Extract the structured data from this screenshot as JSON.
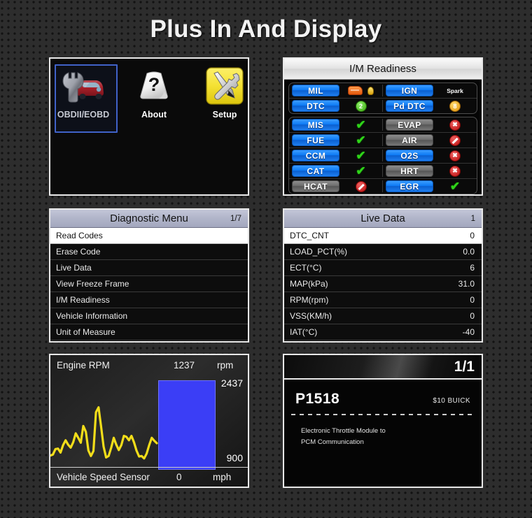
{
  "page": {
    "title": "Plus In And Display"
  },
  "main_menu": {
    "items": [
      {
        "label": "OBDII/EOBD",
        "icon": "wrench-car-icon",
        "selected": true
      },
      {
        "label": "About",
        "icon": "question-mark-icon",
        "selected": false
      },
      {
        "label": "Setup",
        "icon": "wrench-screwdriver-icon",
        "selected": false
      }
    ]
  },
  "im_readiness": {
    "title": "I/M Readiness",
    "group1": [
      {
        "left_label": "MIL",
        "left_style": "blue",
        "left_status": "engine-lamp-icon",
        "right_label": "IGN",
        "right_style": "blue",
        "right_status": "Spark"
      },
      {
        "left_label": "DTC",
        "left_style": "blue",
        "left_status": "2",
        "right_label": "Pd DTC",
        "right_style": "blue",
        "right_status": "8"
      }
    ],
    "group2": [
      {
        "left_label": "MIS",
        "left_style": "blue",
        "left_status": "tick",
        "right_label": "EVAP",
        "right_style": "grey",
        "right_status": "cross"
      },
      {
        "left_label": "FUE",
        "left_style": "blue",
        "left_status": "tick",
        "right_label": "AIR",
        "right_style": "grey",
        "right_status": "noentry"
      },
      {
        "left_label": "CCM",
        "left_style": "blue",
        "left_status": "tick",
        "right_label": "O2S",
        "right_style": "blue",
        "right_status": "cross"
      },
      {
        "left_label": "CAT",
        "left_style": "blue",
        "left_status": "tick",
        "right_label": "HRT",
        "right_style": "grey",
        "right_status": "cross"
      },
      {
        "left_label": "HCAT",
        "left_style": "grey",
        "left_status": "noentry",
        "right_label": "EGR",
        "right_style": "blue",
        "right_status": "tick"
      }
    ]
  },
  "diagnostic_menu": {
    "title": "Diagnostic Menu",
    "page": "1/7",
    "items": [
      {
        "label": "Read Codes",
        "selected": true
      },
      {
        "label": "Erase Code",
        "selected": false
      },
      {
        "label": "Live Data",
        "selected": false
      },
      {
        "label": "View Freeze Frame",
        "selected": false
      },
      {
        "label": "I/M Readiness",
        "selected": false
      },
      {
        "label": "Vehicle Information",
        "selected": false
      },
      {
        "label": "Unit of Measure",
        "selected": false
      }
    ]
  },
  "live_data": {
    "title": "Live Data",
    "page": "1",
    "rows": [
      {
        "name": "DTC_CNT",
        "value": "0",
        "selected": true
      },
      {
        "name": "LOAD_PCT(%)",
        "value": "0.0",
        "selected": false
      },
      {
        "name": "ECT(°C)",
        "value": "6",
        "selected": false
      },
      {
        "name": "MAP(kPa)",
        "value": "31.0",
        "selected": false
      },
      {
        "name": "RPM(rpm)",
        "value": "0",
        "selected": false
      },
      {
        "name": "VSS(KM/h)",
        "value": "0",
        "selected": false
      },
      {
        "name": "IAT(°C)",
        "value": "-40",
        "selected": false
      }
    ]
  },
  "graph": {
    "top_label": "Engine RPM",
    "top_value": "1237",
    "top_unit": "rpm",
    "max_label": "2437",
    "min_label": "900",
    "bottom_label": "Vehicle Speed Sensor",
    "bottom_value": "0",
    "bottom_unit": "mph",
    "trace_color": "#f2dd1a",
    "bar_color": "#3b3ef6"
  },
  "dtc": {
    "page": "1/1",
    "code": "P1518",
    "meta": "$10   BUICK",
    "description_line1": "Electronic Throttle Module to",
    "description_line2": "PCM Communication"
  },
  "chart_data": {
    "type": "line",
    "title": "Engine RPM",
    "ylabel": "rpm",
    "ylim": [
      900,
      2437
    ],
    "current_value": 1237,
    "x": [
      0,
      1,
      2,
      3,
      4,
      5,
      6,
      7,
      8,
      9,
      10,
      11,
      12,
      13,
      14,
      15,
      16,
      17,
      18,
      19,
      20,
      21,
      22,
      23,
      24,
      25,
      26,
      27,
      28,
      29,
      30,
      31,
      32,
      33,
      34,
      35,
      36,
      37,
      38,
      39,
      40,
      41,
      42
    ],
    "values": [
      1020,
      1040,
      1150,
      1160,
      1080,
      1230,
      1330,
      1240,
      1180,
      1290,
      1470,
      1380,
      1280,
      1620,
      1500,
      1120,
      1010,
      1110,
      1900,
      2000,
      1610,
      1200,
      980,
      1010,
      1180,
      1380,
      1240,
      1130,
      1230,
      1420,
      1400,
      1330,
      1420,
      1290,
      1120,
      1000,
      1010,
      960,
      1060,
      1230,
      1380,
      1320,
      1270
    ],
    "grid": false,
    "legend": "none"
  }
}
